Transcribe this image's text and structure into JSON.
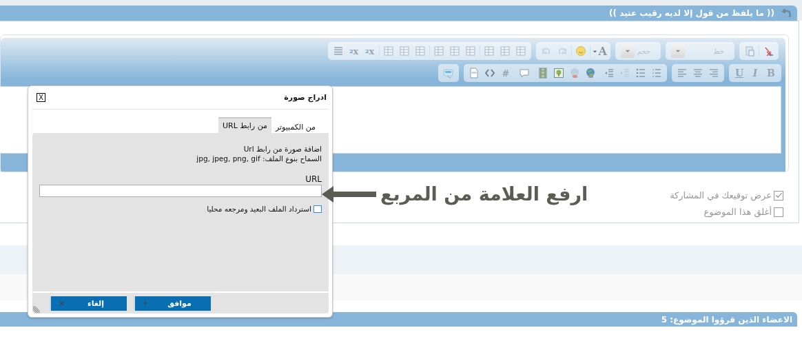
{
  "thread_title": "(( ما يلفظ من قول إلا لديه رقيب عتيد ))",
  "toolbar": [
    [
      {
        "items": [
          {
            "kind": "icon"
          },
          {
            "kind": "separator"
          },
          {
            "kind": "icon"
          }
        ]
      },
      {
        "items": [
          {
            "kind": "dropdown",
            "placeholder": "خط"
          }
        ]
      },
      {
        "items": [
          {
            "kind": "dropdown",
            "placeholder": "حجم"
          }
        ]
      },
      {
        "items": [
          {
            "kind": "color",
            "label": "A"
          },
          {
            "kind": "separator"
          },
          {
            "kind": "icon"
          },
          {
            "kind": "separator"
          },
          {
            "kind": "icon"
          },
          {
            "kind": "icon"
          }
        ]
      },
      {
        "items": [
          {
            "kind": "icon"
          },
          {
            "kind": "icon"
          },
          {
            "kind": "icon"
          },
          {
            "kind": "separator"
          },
          {
            "kind": "icon"
          },
          {
            "kind": "icon"
          },
          {
            "kind": "icon"
          },
          {
            "kind": "separator"
          },
          {
            "kind": "icon"
          },
          {
            "kind": "icon"
          },
          {
            "kind": "icon"
          },
          {
            "kind": "separator"
          },
          {
            "kind": "letter",
            "label": "x$_{2}$"
          },
          {
            "kind": "letter",
            "label": "x$^{2}$"
          },
          {
            "kind": "icon"
          }
        ]
      }
    ],
    [
      {
        "items": [
          {
            "kind": "bold",
            "label": "B"
          },
          {
            "kind": "italic",
            "label": "I"
          },
          {
            "kind": "underline",
            "label": "U"
          }
        ]
      },
      {
        "items": [
          {
            "kind": "icon"
          },
          {
            "kind": "icon"
          },
          {
            "kind": "icon"
          }
        ]
      },
      {
        "items": [
          {
            "kind": "icon"
          },
          {
            "kind": "icon"
          },
          {
            "kind": "icon"
          },
          {
            "kind": "icon"
          },
          {
            "kind": "separator"
          },
          {
            "kind": "icon"
          },
          {
            "kind": "icon"
          },
          {
            "kind": "icon"
          },
          {
            "kind": "icon"
          },
          {
            "kind": "separator"
          },
          {
            "kind": "icon"
          },
          {
            "kind": "separator"
          },
          {
            "kind": "letter",
            "label": "#"
          },
          {
            "kind": "icon"
          },
          {
            "kind": "icon"
          }
        ]
      },
      {
        "items": [
          {
            "kind": "icon"
          }
        ]
      }
    ]
  ],
  "options": [
    {
      "label": "عرض توقيعك في المشاركة",
      "checked": true
    },
    {
      "label": "أغلق هذا الموضوع",
      "checked": false
    }
  ],
  "readers_title": "الاعضاء الذين قرؤوا الموضوع: 5",
  "dialog": {
    "title": "ادراج صورة",
    "close": "X",
    "tabs": [
      {
        "label": "من الكمبيوتر",
        "selected": false
      },
      {
        "label": "من رابط URL",
        "selected": true
      }
    ],
    "heading": "اضافة صورة من رابط Url",
    "allowed": "السماح بنوع الملف: jpg, jpeg, png, gif",
    "url_label": "URL",
    "retrieve": {
      "label": "استرداد الملف البعيد ومرجعه محليا",
      "checked": false
    },
    "buttons": [
      {
        "label": "موافق",
        "kind": "ok"
      },
      {
        "label": "إلغاء",
        "kind": "cancel"
      }
    ]
  },
  "annotation": "ارفع العلامة من المربع"
}
